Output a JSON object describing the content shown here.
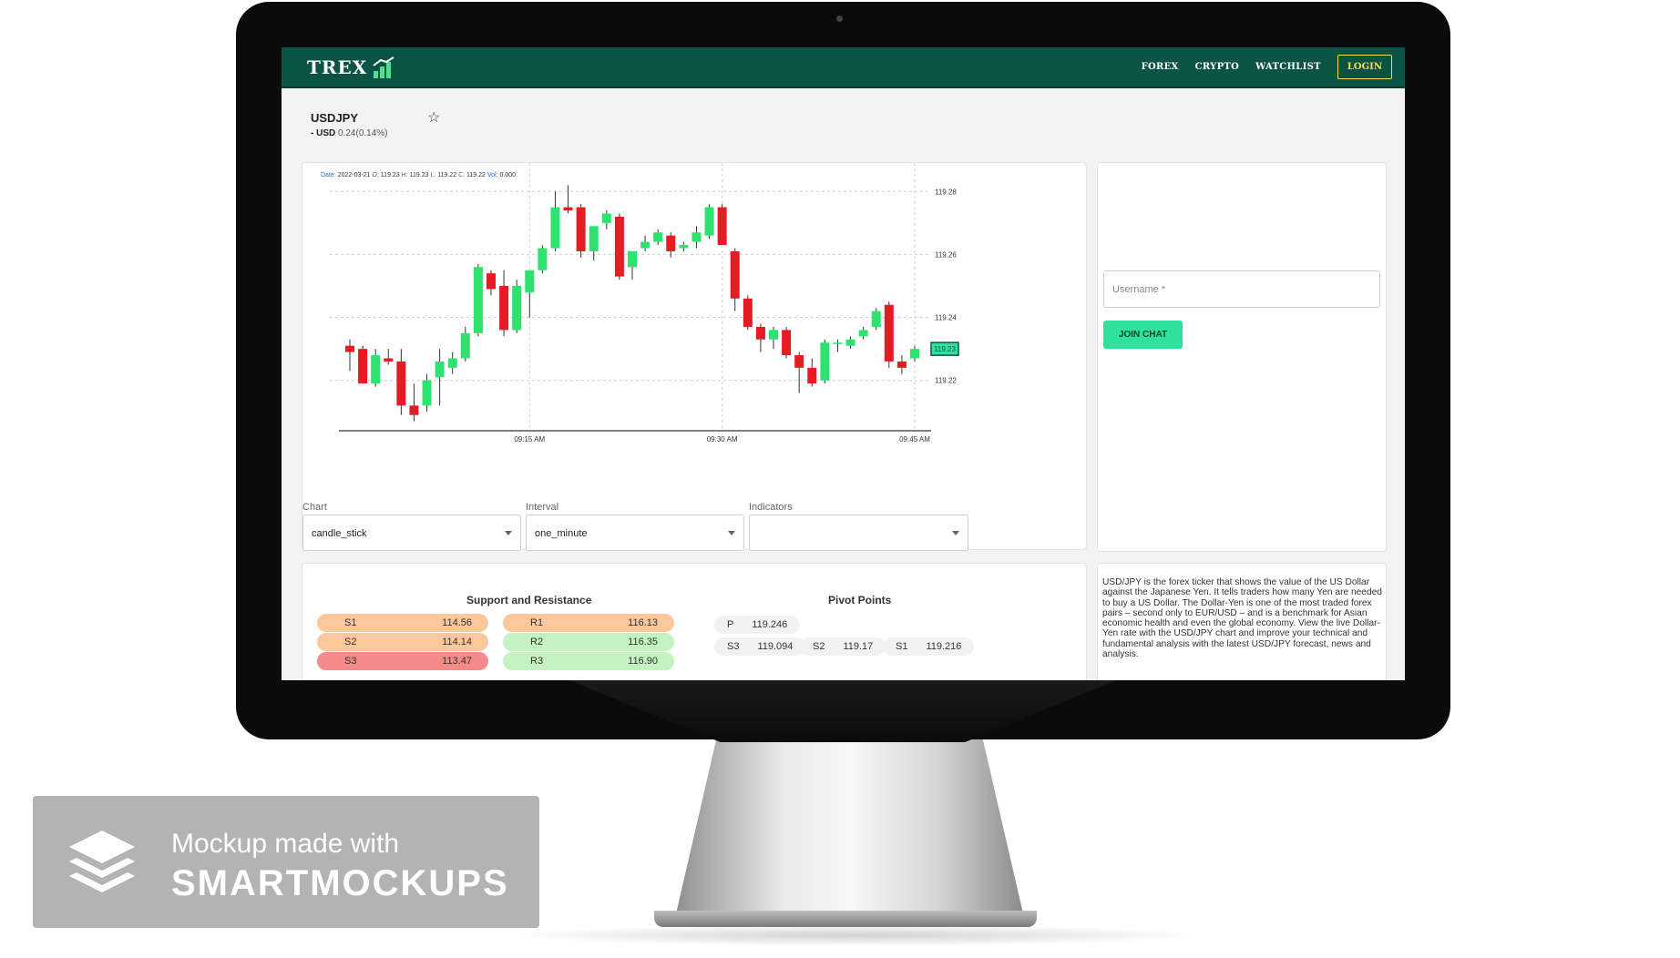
{
  "nav": {
    "logo": "TREX",
    "links": [
      "FOREX",
      "CRYPTO",
      "WATCHLIST"
    ],
    "login": "LOGIN"
  },
  "ticker": {
    "symbol": "USDJPY",
    "prefix": "-",
    "currency": "USD",
    "change": "0.24(0.14%)"
  },
  "chart": {
    "ohlc": {
      "date_label": "Date:",
      "date": "2022-03-21",
      "o_label": "O:",
      "o": "119.23",
      "h_label": "H:",
      "h": "119.23",
      "l_label": "L:",
      "l": "119.22",
      "c_label": "C:",
      "c": "119.22",
      "vol_label": "Vol:",
      "vol": "0.000"
    },
    "current_price": "119.23"
  },
  "chart_data": {
    "type": "candlestick",
    "y_ticks": [
      "119.28",
      "119.26",
      "119.24",
      "119.22"
    ],
    "x_ticks": [
      "09:15 AM",
      "09:30 AM",
      "09:45 AM"
    ],
    "ylim": [
      119.204,
      119.285
    ],
    "colors": {
      "up": "#2ee26f",
      "down": "#e51c23"
    },
    "candles": [
      {
        "o": 119.231,
        "h": 119.233,
        "l": 119.223,
        "c": 119.229
      },
      {
        "o": 119.23,
        "h": 119.231,
        "l": 119.22,
        "c": 119.219
      },
      {
        "o": 119.219,
        "h": 119.23,
        "l": 119.218,
        "c": 119.228
      },
      {
        "o": 119.227,
        "h": 119.23,
        "l": 119.225,
        "c": 119.226
      },
      {
        "o": 119.226,
        "h": 119.23,
        "l": 119.209,
        "c": 119.212
      },
      {
        "o": 119.212,
        "h": 119.219,
        "l": 119.207,
        "c": 119.209
      },
      {
        "o": 119.212,
        "h": 119.222,
        "l": 119.21,
        "c": 119.22
      },
      {
        "o": 119.221,
        "h": 119.23,
        "l": 119.212,
        "c": 119.226
      },
      {
        "o": 119.224,
        "h": 119.229,
        "l": 119.222,
        "c": 119.227
      },
      {
        "o": 119.227,
        "h": 119.237,
        "l": 119.226,
        "c": 119.235
      },
      {
        "o": 119.235,
        "h": 119.257,
        "l": 119.234,
        "c": 119.256
      },
      {
        "o": 119.254,
        "h": 119.255,
        "l": 119.247,
        "c": 119.249
      },
      {
        "o": 119.25,
        "h": 119.255,
        "l": 119.234,
        "c": 119.236
      },
      {
        "o": 119.236,
        "h": 119.252,
        "l": 119.235,
        "c": 119.25
      },
      {
        "o": 119.248,
        "h": 119.255,
        "l": 119.24,
        "c": 119.255
      },
      {
        "o": 119.255,
        "h": 119.263,
        "l": 119.254,
        "c": 119.262
      },
      {
        "o": 119.262,
        "h": 119.28,
        "l": 119.261,
        "c": 119.275
      },
      {
        "o": 119.275,
        "h": 119.282,
        "l": 119.273,
        "c": 119.274
      },
      {
        "o": 119.275,
        "h": 119.276,
        "l": 119.259,
        "c": 119.261
      },
      {
        "o": 119.261,
        "h": 119.268,
        "l": 119.258,
        "c": 119.269
      },
      {
        "o": 119.27,
        "h": 119.274,
        "l": 119.268,
        "c": 119.273
      },
      {
        "o": 119.272,
        "h": 119.273,
        "l": 119.252,
        "c": 119.253
      },
      {
        "o": 119.256,
        "h": 119.257,
        "l": 119.252,
        "c": 119.261
      },
      {
        "o": 119.262,
        "h": 119.266,
        "l": 119.261,
        "c": 119.264
      },
      {
        "o": 119.264,
        "h": 119.268,
        "l": 119.263,
        "c": 119.267
      },
      {
        "o": 119.266,
        "h": 119.267,
        "l": 119.259,
        "c": 119.261
      },
      {
        "o": 119.262,
        "h": 119.264,
        "l": 119.261,
        "c": 119.263
      },
      {
        "o": 119.264,
        "h": 119.269,
        "l": 119.262,
        "c": 119.267
      },
      {
        "o": 119.266,
        "h": 119.276,
        "l": 119.265,
        "c": 119.275
      },
      {
        "o": 119.275,
        "h": 119.276,
        "l": 119.264,
        "c": 119.263
      },
      {
        "o": 119.261,
        "h": 119.262,
        "l": 119.242,
        "c": 119.246
      },
      {
        "o": 119.246,
        "h": 119.247,
        "l": 119.236,
        "c": 119.237
      },
      {
        "o": 119.237,
        "h": 119.238,
        "l": 119.229,
        "c": 119.233
      },
      {
        "o": 119.233,
        "h": 119.237,
        "l": 119.23,
        "c": 119.236
      },
      {
        "o": 119.236,
        "h": 119.237,
        "l": 119.227,
        "c": 119.228
      },
      {
        "o": 119.228,
        "h": 119.229,
        "l": 119.216,
        "c": 119.224
      },
      {
        "o": 119.224,
        "h": 119.227,
        "l": 119.218,
        "c": 119.219
      },
      {
        "o": 119.22,
        "h": 119.233,
        "l": 119.219,
        "c": 119.232
      },
      {
        "o": 119.232,
        "h": 119.233,
        "l": 119.229,
        "c": 119.232
      },
      {
        "o": 119.231,
        "h": 119.234,
        "l": 119.23,
        "c": 119.233
      },
      {
        "o": 119.234,
        "h": 119.237,
        "l": 119.233,
        "c": 119.236
      },
      {
        "o": 119.237,
        "h": 119.243,
        "l": 119.236,
        "c": 119.242
      },
      {
        "o": 119.244,
        "h": 119.245,
        "l": 119.224,
        "c": 119.226
      },
      {
        "o": 119.226,
        "h": 119.228,
        "l": 119.222,
        "c": 119.224
      },
      {
        "o": 119.227,
        "h": 119.231,
        "l": 119.226,
        "c": 119.23
      }
    ]
  },
  "controls": {
    "chart_label": "Chart",
    "chart_value": "candle_stick",
    "interval_label": "Interval",
    "interval_value": "one_minute",
    "indicators_label": "Indicators",
    "indicators_value": ""
  },
  "chat": {
    "username_placeholder": "Username *",
    "join_label": "JOIN CHAT"
  },
  "support_resistance": {
    "title": "Support and Resistance",
    "support": [
      {
        "label": "S1",
        "value": "114.56",
        "color": "#fbc79b"
      },
      {
        "label": "S2",
        "value": "114.14",
        "color": "#fbc79b"
      },
      {
        "label": "S3",
        "value": "113.47",
        "color": "#f48a8a"
      }
    ],
    "resistance": [
      {
        "label": "R1",
        "value": "116.13",
        "color": "#fbc79b"
      },
      {
        "label": "R2",
        "value": "116.35",
        "color": "#c4f2c0"
      },
      {
        "label": "R3",
        "value": "116.90",
        "color": "#c4f2c0"
      }
    ]
  },
  "pivot_points": {
    "title": "Pivot Points",
    "p": {
      "label": "P",
      "value": "119.246"
    },
    "row": [
      {
        "label": "S3",
        "value": "119.094"
      },
      {
        "label": "S2",
        "value": "119.17"
      },
      {
        "label": "S1",
        "value": "119.216"
      }
    ]
  },
  "description": "USD/JPY is the forex ticker that shows the value of the US Dollar against the Japanese Yen. It tells traders how many Yen are needed to buy a US Dollar. The Dollar-Yen is one of the most traded forex pairs – second only to EUR/USD – and is a benchmark for Asian economic health and even the global economy. View the live Dollar-Yen rate with the USD/JPY chart and improve your technical and fundamental analysis with the latest USD/JPY forecast, news and analysis.",
  "watermark": {
    "line1": "Mockup made with",
    "line2": "SMARTMOCKUPS"
  }
}
